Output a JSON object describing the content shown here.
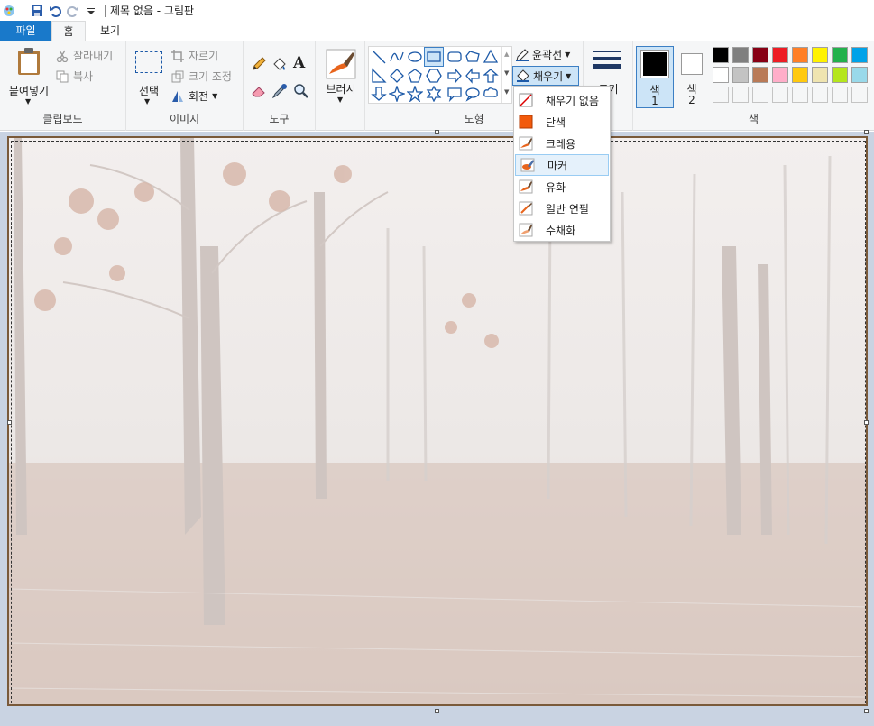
{
  "window": {
    "title": "제목 없음 - 그림판"
  },
  "tabs": {
    "file": "파일",
    "home": "홈",
    "view": "보기"
  },
  "clipboard": {
    "paste": "붙여넣기",
    "cut": "잘라내기",
    "copy": "복사",
    "group_label": "클립보드"
  },
  "image": {
    "select": "선택",
    "crop": "자르기",
    "resize": "크기 조정",
    "rotate": "회전",
    "group_label": "이미지"
  },
  "tools": {
    "group_label": "도구"
  },
  "brushes": {
    "label": "브러시"
  },
  "shapes": {
    "outline": "윤곽선",
    "fill": "채우기",
    "group_label": "도형"
  },
  "size": {
    "label": "크기"
  },
  "colors": {
    "color1_label": "색",
    "color1_num": "1",
    "color2_label": "색",
    "color2_num": "2",
    "group_label": "색",
    "color1_value": "#000000",
    "color2_value": "#ffffff",
    "palette_row1": [
      "#000000",
      "#7f7f7f",
      "#880015",
      "#ed1c24",
      "#ff7f27",
      "#fff200",
      "#22b14c",
      "#00a2e8"
    ],
    "palette_row2": [
      "#ffffff",
      "#c3c3c3",
      "#b97a57",
      "#ffaec9",
      "#ffc90e",
      "#efe4b0",
      "#b5e61d",
      "#99d9ea"
    ]
  },
  "fill_menu": {
    "items": [
      "채우기 없음",
      "단색",
      "크레용",
      "마커",
      "유화",
      "일반 연필",
      "수채화"
    ],
    "highlighted_index": 3
  }
}
